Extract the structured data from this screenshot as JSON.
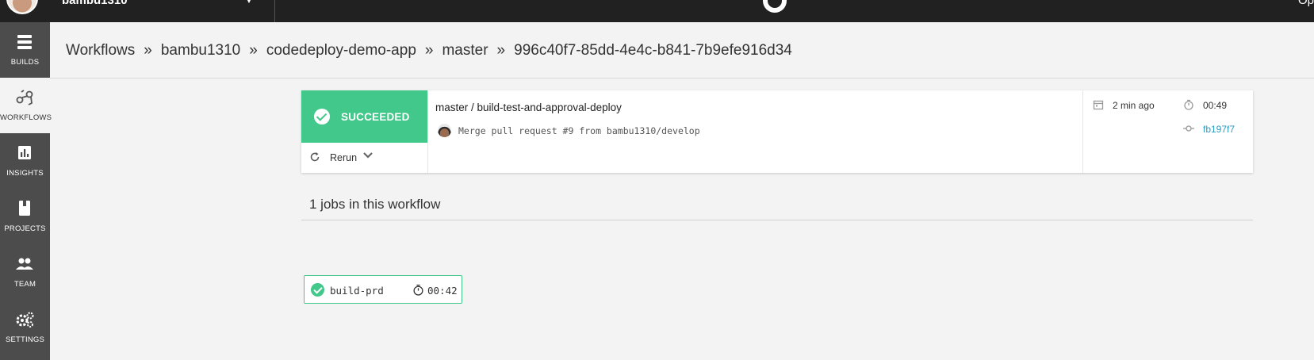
{
  "topbar": {
    "org_name": "bambu1310",
    "right_text": "Op"
  },
  "sidebar": {
    "items": [
      {
        "label": "BUILDS",
        "icon": "builds-icon"
      },
      {
        "label": "WORKFLOWS",
        "icon": "workflows-icon",
        "active": true
      },
      {
        "label": "INSIGHTS",
        "icon": "insights-icon"
      },
      {
        "label": "PROJECTS",
        "icon": "projects-icon"
      },
      {
        "label": "TEAM",
        "icon": "team-icon"
      },
      {
        "label": "SETTINGS",
        "icon": "settings-icon"
      }
    ]
  },
  "breadcrumb": {
    "items": [
      "Workflows",
      "bambu1310",
      "codedeploy-demo-app",
      "master",
      "996c40f7-85dd-4e4c-b841-7b9efe916d34"
    ],
    "separator": "»"
  },
  "workflow": {
    "status": "SUCCEEDED",
    "status_color": "#42c88a",
    "rerun_label": "Rerun",
    "name": "master / build-test-and-approval-deploy",
    "commit_message": "Merge pull request #9 from bambu1310/develop",
    "time_ago": "2 min ago",
    "duration": "00:49",
    "commit_sha": "fb197f7"
  },
  "jobs": {
    "title": "1 jobs in this workflow",
    "items": [
      {
        "name": "build-prd",
        "duration": "00:42",
        "status": "success"
      }
    ]
  }
}
